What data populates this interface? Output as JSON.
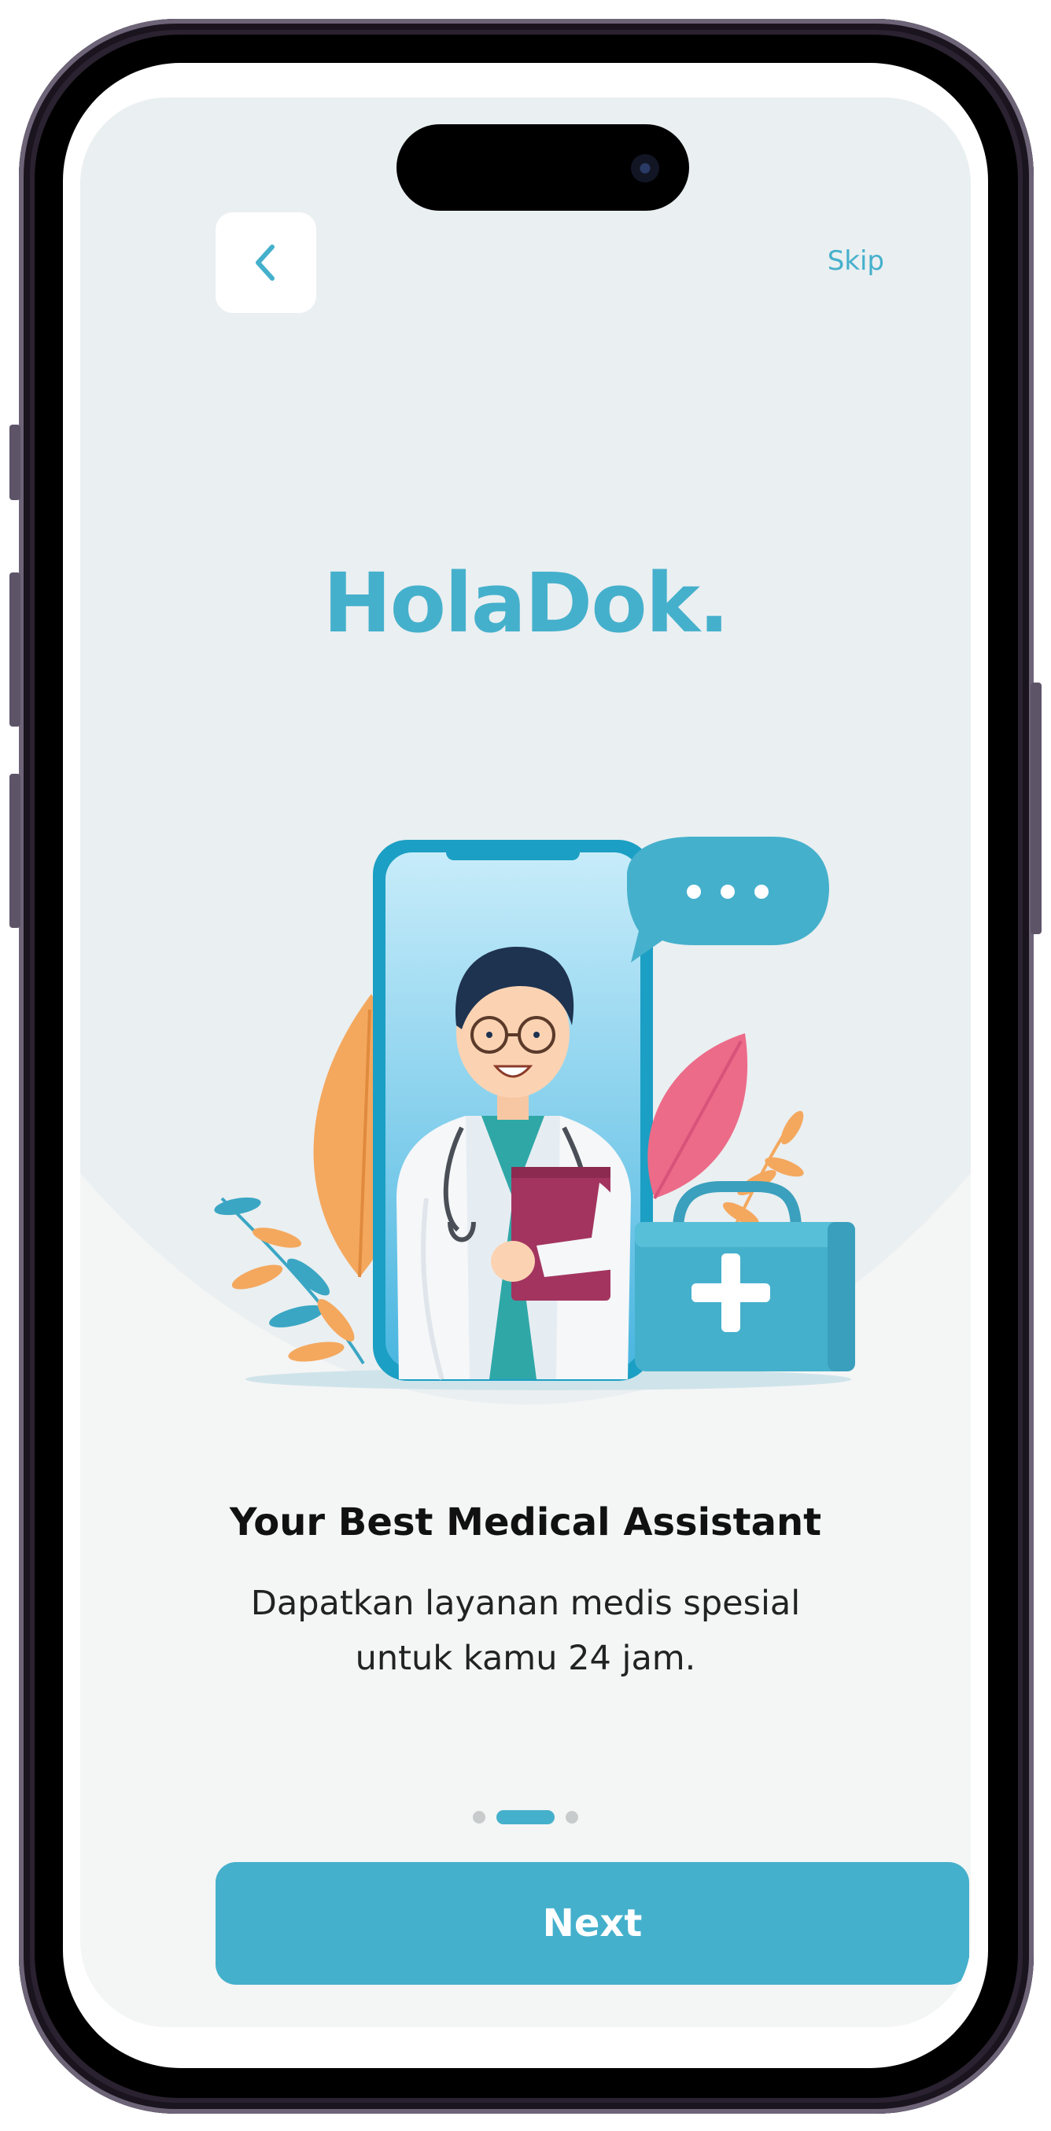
{
  "header": {
    "back_icon": "chevron-left-icon",
    "skip_label": "Skip"
  },
  "brand": {
    "name": "HolaDok."
  },
  "onboarding": {
    "title": "Your Best Medical Assistant",
    "subtitle": "Dapatkan layanan medis spesial untuk kamu 24 jam.",
    "page_indicator": {
      "total": 3,
      "active": 2
    }
  },
  "actions": {
    "next_label": "Next"
  },
  "colors": {
    "accent": "#45b0cc",
    "background": "#f4f5f5",
    "hero_background": "#eaeff1",
    "title": "#111111"
  }
}
